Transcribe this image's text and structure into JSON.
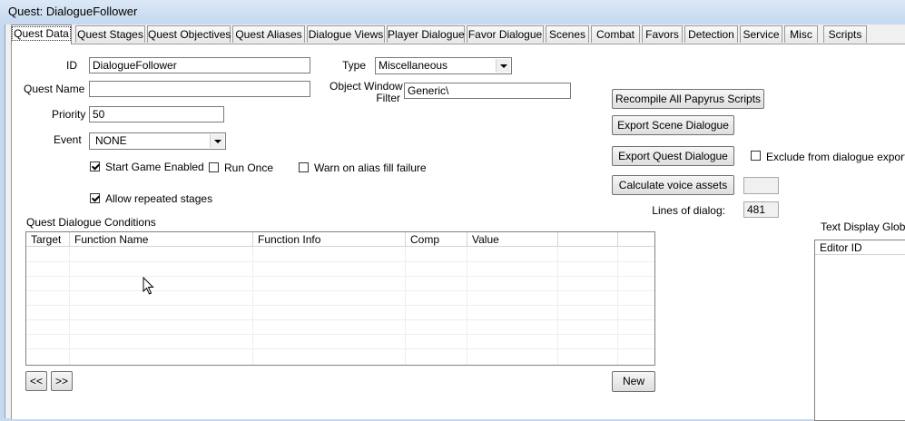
{
  "window": {
    "title": "Quest: DialogueFollower"
  },
  "tabs": [
    "Quest Data",
    "Quest Stages",
    "Quest Objectives",
    "Quest Aliases",
    "Dialogue Views",
    "Player Dialogue",
    "Favor Dialogue",
    "Scenes",
    "Combat",
    "Favors",
    "Detection",
    "Service",
    "Misc",
    "Scripts"
  ],
  "form": {
    "id_label": "ID",
    "id_value": "DialogueFollower",
    "quest_name_label": "Quest Name",
    "quest_name_value": "",
    "priority_label": "Priority",
    "priority_value": "50",
    "event_label": "Event",
    "event_value": "NONE",
    "type_label": "Type",
    "type_value": "Miscellaneous",
    "object_window_filter_label_1": "Object Window",
    "object_window_filter_label_2": "Filter",
    "object_window_filter_value": "Generic\\"
  },
  "checkboxes": {
    "start_game_enabled": {
      "label": "Start Game Enabled",
      "checked": true
    },
    "run_once": {
      "label": "Run Once",
      "checked": false
    },
    "warn_alias": {
      "label": "Warn on alias fill failure",
      "checked": false
    },
    "allow_repeated": {
      "label": "Allow repeated stages",
      "checked": true
    },
    "exclude_export": {
      "label": "Exclude from dialogue export",
      "checked": false
    }
  },
  "buttons": {
    "recompile": "Recompile All Papyrus Scripts",
    "export_scene": "Export Scene Dialogue",
    "export_quest": "Export Quest Dialogue",
    "calc_voice": "Calculate voice assets",
    "prev": "<<",
    "next": ">>",
    "new": "New"
  },
  "calc_voice_value": "",
  "lines_of_dialog": {
    "label": "Lines of dialog:",
    "value": "481"
  },
  "conditions": {
    "title": "Quest Dialogue Conditions",
    "columns": [
      "Target",
      "Function Name",
      "Function Info",
      "Comp",
      "Value",
      ""
    ]
  },
  "text_display_globals": {
    "title": "Text Display Globals",
    "columns": [
      "Editor ID"
    ]
  }
}
